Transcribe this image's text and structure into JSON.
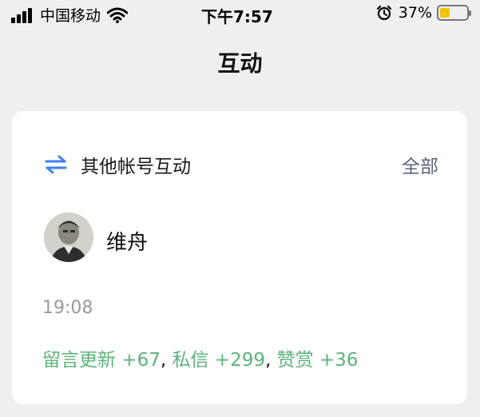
{
  "status_bar": {
    "carrier": "中国移动",
    "time": "下午7:57",
    "battery_percent": "37%",
    "battery_level": 0.37,
    "icons": [
      "signal-icon",
      "wifi-icon",
      "alarm-icon",
      "battery-icon"
    ]
  },
  "nav": {
    "title": "互动"
  },
  "card": {
    "title": "其他帐号互动",
    "all_label": "全部",
    "icon": "swap-icon",
    "user": {
      "name": "维舟"
    },
    "timestamp": "19:08",
    "stats": {
      "comments": "留言更新 +67",
      "sep1": ", ",
      "messages": "私信 +299",
      "sep2": ", ",
      "rewards": "赞赏 +36"
    }
  },
  "colors": {
    "accent_green": "#5cb37b",
    "link_gray": "#5a6478",
    "swap_blue": "#3b82f6"
  }
}
